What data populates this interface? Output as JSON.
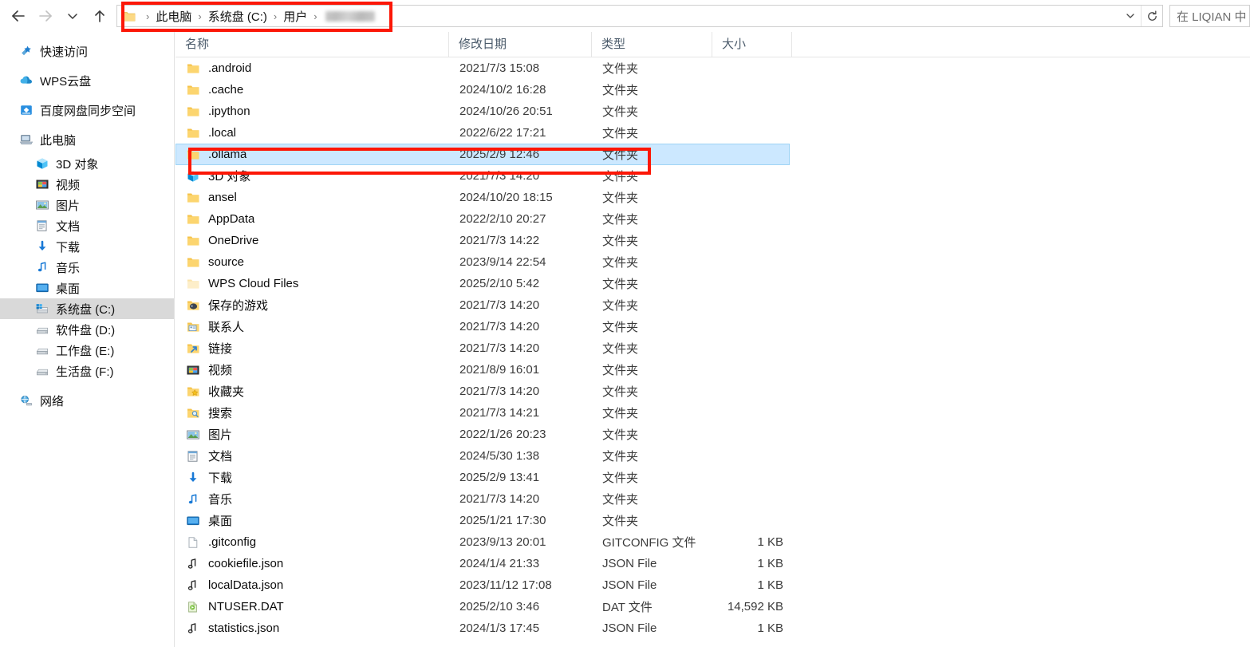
{
  "window": {
    "title": "File Explorer",
    "accent_blue": "#cce8ff",
    "annotation_color": "#fc1707"
  },
  "toolbar": {
    "back_label": "后退",
    "forward_label": "前进",
    "recent_label": "最近使用的位置",
    "up_label": "上移一级",
    "icons": {
      "back": "arrow-left-icon",
      "forward": "arrow-right-icon",
      "recent": "chevron-down-icon",
      "up": "arrow-up-icon",
      "address_folder": "folder-icon",
      "address_dropdown": "chevron-down-icon",
      "refresh": "refresh-icon"
    }
  },
  "address_bar": {
    "crumbs": [
      {
        "label": "此电脑",
        "blurred": false
      },
      {
        "label": "系统盘 (C:)",
        "blurred": false
      },
      {
        "label": "用户",
        "blurred": false
      },
      {
        "label": "",
        "blurred": true
      }
    ],
    "separator": "›"
  },
  "search": {
    "placeholder": "在 LIQIAN 中"
  },
  "sidebar": {
    "items": [
      {
        "label": "快速访问",
        "icon": "pin-star-icon",
        "indent": false,
        "selected": false
      },
      {
        "label": "WPS云盘",
        "icon": "cloud-icon",
        "indent": false,
        "selected": false
      },
      {
        "label": "百度网盘同步空间",
        "icon": "baidu-netdisk-icon",
        "indent": false,
        "selected": false
      },
      {
        "label": "此电脑",
        "icon": "this-pc-icon",
        "indent": false,
        "selected": false
      },
      {
        "label": "3D 对象",
        "icon": "3d-objects-icon",
        "indent": true,
        "selected": false
      },
      {
        "label": "视频",
        "icon": "videos-icon",
        "indent": true,
        "selected": false
      },
      {
        "label": "图片",
        "icon": "pictures-icon",
        "indent": true,
        "selected": false
      },
      {
        "label": "文档",
        "icon": "documents-icon",
        "indent": true,
        "selected": false
      },
      {
        "label": "下载",
        "icon": "downloads-icon",
        "indent": true,
        "selected": false
      },
      {
        "label": "音乐",
        "icon": "music-icon",
        "indent": true,
        "selected": false
      },
      {
        "label": "桌面",
        "icon": "desktop-icon",
        "indent": true,
        "selected": false
      },
      {
        "label": "系统盘 (C:)",
        "icon": "windows-drive-icon",
        "indent": true,
        "selected": true
      },
      {
        "label": "软件盘 (D:)",
        "icon": "drive-icon",
        "indent": true,
        "selected": false
      },
      {
        "label": "工作盘 (E:)",
        "icon": "drive-icon",
        "indent": true,
        "selected": false
      },
      {
        "label": "生活盘 (F:)",
        "icon": "drive-icon",
        "indent": true,
        "selected": false
      },
      {
        "label": "网络",
        "icon": "network-icon",
        "indent": false,
        "selected": false
      }
    ]
  },
  "file_list": {
    "columns": [
      {
        "key": "name",
        "label": "名称"
      },
      {
        "key": "date",
        "label": "修改日期"
      },
      {
        "key": "type",
        "label": "类型"
      },
      {
        "key": "size",
        "label": "大小"
      }
    ],
    "rows": [
      {
        "name": ".android",
        "date": "2021/7/3 15:08",
        "type": "文件夹",
        "size": "",
        "icon": "folder-icon",
        "selected": false
      },
      {
        "name": ".cache",
        "date": "2024/10/2 16:28",
        "type": "文件夹",
        "size": "",
        "icon": "folder-icon",
        "selected": false
      },
      {
        "name": ".ipython",
        "date": "2024/10/26 20:51",
        "type": "文件夹",
        "size": "",
        "icon": "folder-icon",
        "selected": false
      },
      {
        "name": ".local",
        "date": "2022/6/22 17:21",
        "type": "文件夹",
        "size": "",
        "icon": "folder-icon",
        "selected": false
      },
      {
        "name": ".ollama",
        "date": "2025/2/9 12:46",
        "type": "文件夹",
        "size": "",
        "icon": "folder-icon",
        "selected": true
      },
      {
        "name": "3D 对象",
        "date": "2021/7/3 14:20",
        "type": "文件夹",
        "size": "",
        "icon": "3d-objects-icon",
        "selected": false
      },
      {
        "name": "ansel",
        "date": "2024/10/20 18:15",
        "type": "文件夹",
        "size": "",
        "icon": "folder-icon",
        "selected": false
      },
      {
        "name": "AppData",
        "date": "2022/2/10 20:27",
        "type": "文件夹",
        "size": "",
        "icon": "folder-icon",
        "selected": false
      },
      {
        "name": "OneDrive",
        "date": "2021/7/3 14:22",
        "type": "文件夹",
        "size": "",
        "icon": "folder-icon",
        "selected": false
      },
      {
        "name": "source",
        "date": "2023/9/14 22:54",
        "type": "文件夹",
        "size": "",
        "icon": "folder-icon",
        "selected": false
      },
      {
        "name": "WPS Cloud Files",
        "date": "2025/2/10 5:42",
        "type": "文件夹",
        "size": "",
        "icon": "folder-pale-icon",
        "selected": false
      },
      {
        "name": "保存的游戏",
        "date": "2021/7/3 14:20",
        "type": "文件夹",
        "size": "",
        "icon": "saved-games-icon",
        "selected": false
      },
      {
        "name": "联系人",
        "date": "2021/7/3 14:20",
        "type": "文件夹",
        "size": "",
        "icon": "contacts-icon",
        "selected": false
      },
      {
        "name": "链接",
        "date": "2021/7/3 14:20",
        "type": "文件夹",
        "size": "",
        "icon": "links-icon",
        "selected": false
      },
      {
        "name": "视频",
        "date": "2021/8/9 16:01",
        "type": "文件夹",
        "size": "",
        "icon": "videos-icon",
        "selected": false
      },
      {
        "name": "收藏夹",
        "date": "2021/7/3 14:20",
        "type": "文件夹",
        "size": "",
        "icon": "favorites-icon",
        "selected": false
      },
      {
        "name": "搜索",
        "date": "2021/7/3 14:21",
        "type": "文件夹",
        "size": "",
        "icon": "searches-icon",
        "selected": false
      },
      {
        "name": "图片",
        "date": "2022/1/26 20:23",
        "type": "文件夹",
        "size": "",
        "icon": "pictures-icon",
        "selected": false
      },
      {
        "name": "文档",
        "date": "2024/5/30 1:38",
        "type": "文件夹",
        "size": "",
        "icon": "documents-icon",
        "selected": false
      },
      {
        "name": "下载",
        "date": "2025/2/9 13:41",
        "type": "文件夹",
        "size": "",
        "icon": "downloads-icon",
        "selected": false
      },
      {
        "name": "音乐",
        "date": "2021/7/3 14:20",
        "type": "文件夹",
        "size": "",
        "icon": "music-icon",
        "selected": false
      },
      {
        "name": "桌面",
        "date": "2025/1/21 17:30",
        "type": "文件夹",
        "size": "",
        "icon": "desktop-icon",
        "selected": false
      },
      {
        "name": ".gitconfig",
        "date": "2023/9/13 20:01",
        "type": "GITCONFIG 文件",
        "size": "1 KB",
        "icon": "blank-file-icon",
        "selected": false
      },
      {
        "name": "cookiefile.json",
        "date": "2024/1/4 21:33",
        "type": "JSON File",
        "size": "1 KB",
        "icon": "json-file-icon",
        "selected": false
      },
      {
        "name": "localData.json",
        "date": "2023/11/12 17:08",
        "type": "JSON File",
        "size": "1 KB",
        "icon": "json-file-icon",
        "selected": false
      },
      {
        "name": "NTUSER.DAT",
        "date": "2025/2/10 3:46",
        "type": "DAT 文件",
        "size": "14,592 KB",
        "icon": "dat-file-icon",
        "selected": false
      },
      {
        "name": "statistics.json",
        "date": "2024/1/3 17:45",
        "type": "JSON File",
        "size": "1 KB",
        "icon": "json-file-icon",
        "selected": false
      }
    ]
  },
  "annotations": [
    {
      "name": "path-highlight",
      "target": "address-bar-breadcrumb"
    },
    {
      "name": "row-highlight",
      "target": "file-row-ollama"
    }
  ]
}
